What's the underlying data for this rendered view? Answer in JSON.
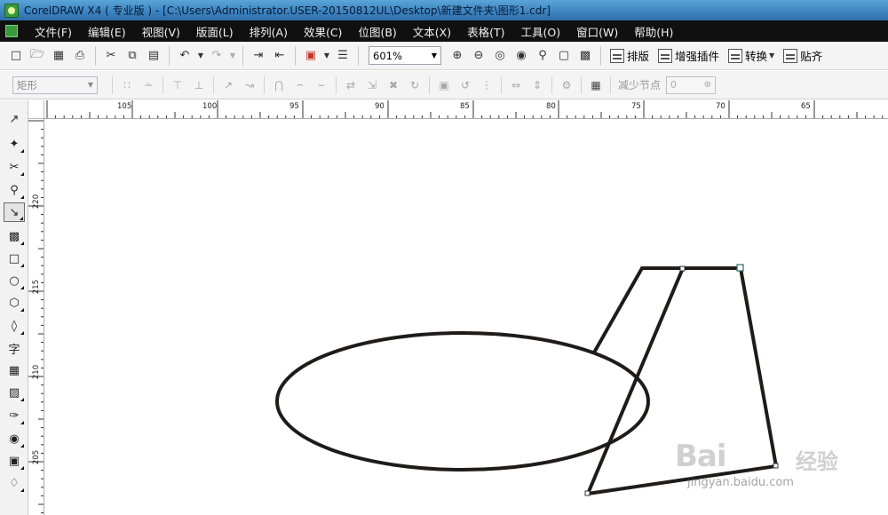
{
  "window": {
    "title": "CorelDRAW X4 ( 专业版 ) - [C:\\Users\\Administrator.USER-20150812UL\\Desktop\\新建文件夹\\图形1.cdr]"
  },
  "menu": {
    "items": [
      "文件(F)",
      "编辑(E)",
      "视图(V)",
      "版面(L)",
      "排列(A)",
      "效果(C)",
      "位图(B)",
      "文本(X)",
      "表格(T)",
      "工具(O)",
      "窗口(W)",
      "帮助(H)"
    ]
  },
  "toolbar": {
    "zoom_value": "601%",
    "plugins": [
      "排版",
      "增强插件",
      "转换",
      "贴齐"
    ]
  },
  "property_bar": {
    "shape_select": "矩形",
    "reduce_nodes_label": "减少节点",
    "reduce_nodes_value": "0"
  },
  "rulers": {
    "horizontal": [
      "105",
      "100",
      "95",
      "90",
      "85",
      "80",
      "75",
      "70",
      "65"
    ],
    "vertical": [
      "220",
      "215",
      "210",
      "205"
    ]
  },
  "watermark": {
    "logo": "Bai",
    "brand": "经验",
    "url": "jingyan.baidu.com"
  }
}
